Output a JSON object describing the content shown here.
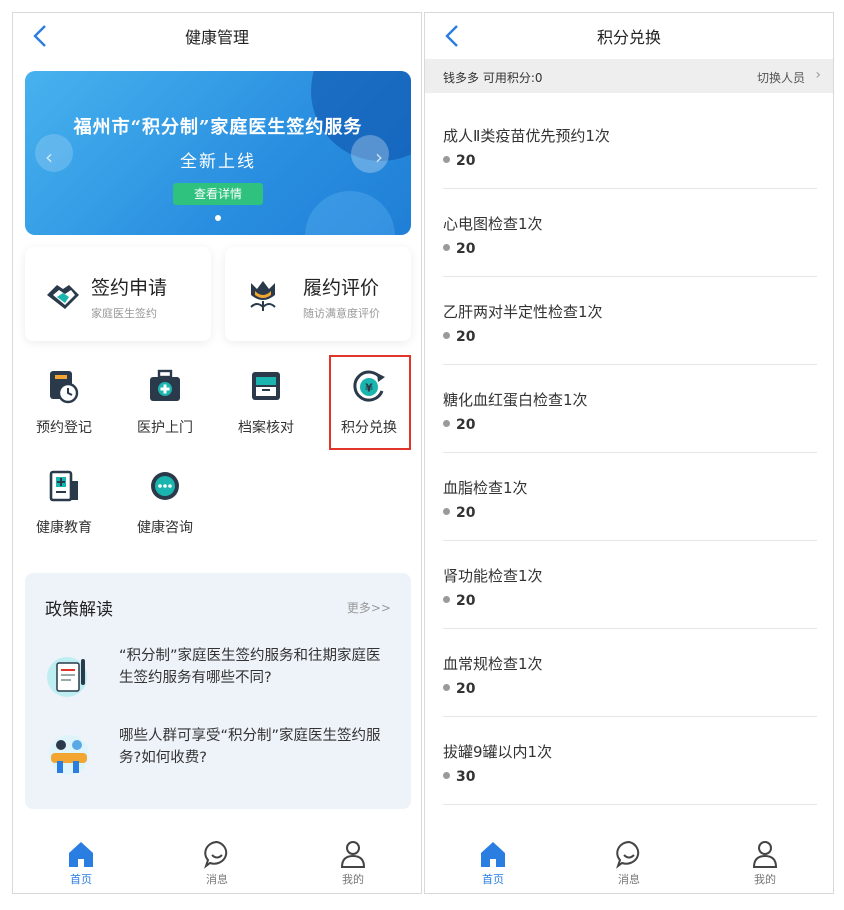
{
  "left": {
    "title": "健康管理",
    "banner": {
      "line1": "福州市“积分制”家庭医生签约服务",
      "line2": "全新上线",
      "button": "查看详情"
    },
    "cards": [
      {
        "title": "签约申请",
        "subtitle": "家庭医生签约",
        "icon": "handshake-icon"
      },
      {
        "title": "履约评价",
        "subtitle": "随访满意度评价",
        "icon": "flower-icon"
      }
    ],
    "grid": [
      {
        "label": "预约登记",
        "icon": "appointment-clock-icon"
      },
      {
        "label": "医护上门",
        "icon": "medical-kit-icon"
      },
      {
        "label": "档案核对",
        "icon": "archive-icon"
      },
      {
        "label": "积分兑换",
        "icon": "points-exchange-icon"
      },
      {
        "label": "健康教育",
        "icon": "health-education-icon"
      },
      {
        "label": "健康咨询",
        "icon": "chat-bubble-icon"
      }
    ],
    "policy": {
      "title": "政策解读",
      "more": "更多>>",
      "items": [
        {
          "text": "“积分制”家庭医生签约服务和往期家庭医生签约服务有哪些不同?",
          "icon": "document-illustration-icon"
        },
        {
          "text": "哪些人群可享受“积分制”家庭医生签约服务?如何收费?",
          "icon": "people-illustration-icon"
        }
      ]
    }
  },
  "right": {
    "title": "积分兑换",
    "user": "钱多多  可用积分:0",
    "switch": "切换人员",
    "items": [
      {
        "name": "成人Ⅱ类疫苗优先预约1次",
        "points": "20"
      },
      {
        "name": "心电图检查1次",
        "points": "20"
      },
      {
        "name": "乙肝两对半定性检查1次",
        "points": "20"
      },
      {
        "name": "糖化血红蛋白检查1次",
        "points": "20"
      },
      {
        "name": "血脂检查1次",
        "points": "20"
      },
      {
        "name": "肾功能检查1次",
        "points": "20"
      },
      {
        "name": "血常规检查1次",
        "points": "20"
      },
      {
        "name": "拔罐9罐以内1次",
        "points": "30"
      }
    ]
  },
  "nav": [
    {
      "label": "首页",
      "icon": "home-icon"
    },
    {
      "label": "消息",
      "icon": "message-icon"
    },
    {
      "label": "我的",
      "icon": "profile-icon"
    }
  ],
  "colors": {
    "accent": "#2a7de1",
    "highlight": "#e0352b",
    "teal": "#1bb5b0",
    "dark": "#2a3a4a"
  }
}
